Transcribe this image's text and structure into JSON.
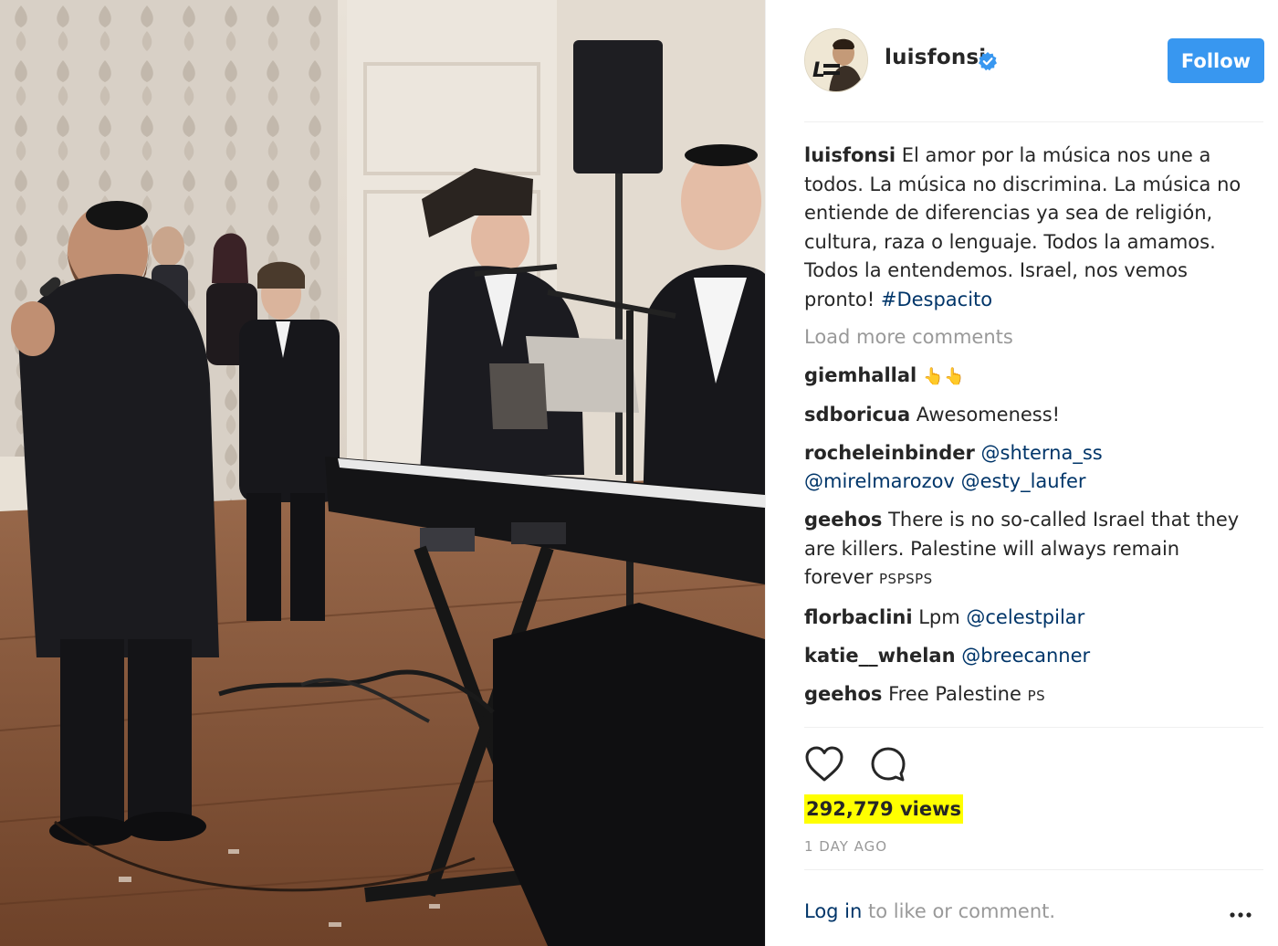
{
  "post": {
    "username": "luisfonsi",
    "follow_label": "Follow",
    "caption": {
      "username": "luisfonsi",
      "text": " El amor por la música nos une a todos. La música no discrimina. La música no entiende de diferencias ya sea de religión, cultura, raza o lenguaje. Todos la amamos. Todos la entendemos. Israel, nos vemos pronto! ",
      "hashtag": "#Despacito"
    },
    "load_more_label": "Load more comments",
    "comments": [
      {
        "username": "giemhallal",
        "text": " ",
        "emoji": "👆👆"
      },
      {
        "username": "sdboricua",
        "text": " Awesomeness!"
      },
      {
        "username": "rocheleinbinder",
        "text": " ",
        "mentions": [
          "@shterna_ss",
          "@mirelmarozov",
          "@esty_laufer"
        ]
      },
      {
        "username": "geehos",
        "text": " There is no so-called Israel that they are killers. Palestine will always remain forever ",
        "flags": "PSPSPS"
      },
      {
        "username": "florbaclini",
        "text": " Lpm ",
        "mention": "@celestpilar"
      },
      {
        "username": "katie__whelan",
        "text": " ",
        "mention": "@breecanner"
      },
      {
        "username": "geehos",
        "text": " Free Palestine ",
        "flags": "PS"
      }
    ],
    "views": "292,779 views",
    "timestamp": "1 DAY AGO",
    "login": {
      "link_label": "Log in",
      "rest": " to like or comment."
    }
  },
  "icons": {
    "verified": "verified-badge-icon",
    "like": "heart-icon",
    "comment": "comment-bubble-icon",
    "more": "more-options-icon"
  },
  "colors": {
    "follow_button": "#3897f0",
    "link": "#003569",
    "muted_text": "#999999",
    "text": "#262626",
    "views_highlight": "#ffff00"
  }
}
